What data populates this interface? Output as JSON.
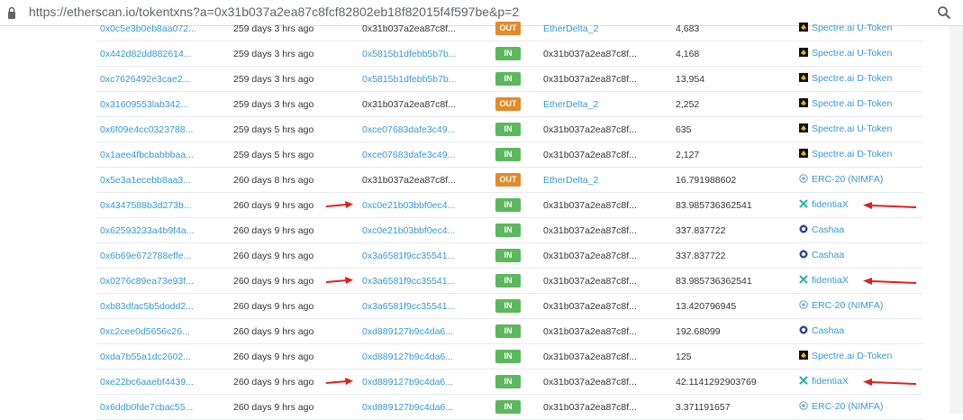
{
  "browser": {
    "url": "https://etherscan.io/tokentxns?a=0x31b037a2ea87c8fcf82802eb18f82015f4f597be&p=2"
  },
  "colors": {
    "link": "#3498db",
    "in_badge": "#5cb85c",
    "out_badge": "#e48a2a",
    "arrow": "#e02020"
  },
  "rows": [
    {
      "hash": "0x0c5e3b0eb8aa072...",
      "age": "259 days 3 hrs ago",
      "from": "0x31b037a2ea87c8f...",
      "from_link": false,
      "dir": "OUT",
      "to": "EtherDelta_2",
      "to_link": true,
      "value": "4,683",
      "token": "Spectre.ai U-Token",
      "icon": "spectre-icon",
      "marked": false
    },
    {
      "hash": "0x442d82dd882614...",
      "age": "259 days 3 hrs ago",
      "from": "0x5815b1dfebb5b7b...",
      "from_link": true,
      "dir": "IN",
      "to": "0x31b037a2ea87c8f...",
      "to_link": false,
      "value": "4,168",
      "token": "Spectre.ai U-Token",
      "icon": "spectre-icon",
      "marked": false
    },
    {
      "hash": "0xc7626492e3cae2...",
      "age": "259 days 3 hrs ago",
      "from": "0x5815b1dfebb5b7b...",
      "from_link": true,
      "dir": "IN",
      "to": "0x31b037a2ea87c8f...",
      "to_link": false,
      "value": "13,954",
      "token": "Spectre.ai D-Token",
      "icon": "spectre-icon",
      "marked": false
    },
    {
      "hash": "0x31609553lab342...",
      "age": "259 days 3 hrs ago",
      "from": "0x31b037a2ea87c8f...",
      "from_link": false,
      "dir": "OUT",
      "to": "EtherDelta_2",
      "to_link": true,
      "value": "2,252",
      "token": "Spectre.ai D-Token",
      "icon": "spectre-icon",
      "marked": false
    },
    {
      "hash": "0x6f09e4cc0323788...",
      "age": "259 days 5 hrs ago",
      "from": "0xce07683dafe3c49...",
      "from_link": true,
      "dir": "IN",
      "to": "0x31b037a2ea87c8f...",
      "to_link": false,
      "value": "635",
      "token": "Spectre.ai U-Token",
      "icon": "spectre-icon",
      "marked": false
    },
    {
      "hash": "0x1aee4fbcbabbbaa...",
      "age": "259 days 5 hrs ago",
      "from": "0xce07683dafe3c49...",
      "from_link": true,
      "dir": "IN",
      "to": "0x31b037a2ea87c8f...",
      "to_link": false,
      "value": "2,127",
      "token": "Spectre.ai D-Token",
      "icon": "spectre-icon",
      "marked": false
    },
    {
      "hash": "0x5e3a1ecebb8aa3...",
      "age": "260 days 8 hrs ago",
      "from": "0x31b037a2ea87c8f...",
      "from_link": false,
      "dir": "OUT",
      "to": "EtherDelta_2",
      "to_link": true,
      "value": "16.791988602",
      "token": "ERC-20 (NIMFA)",
      "icon": "erc20-icon",
      "marked": false
    },
    {
      "hash": "0x4347588b3d273b...",
      "age": "260 days 9 hrs ago",
      "from": "0xc0e21b03bbf0ec4...",
      "from_link": true,
      "dir": "IN",
      "to": "0x31b037a2ea87c8f...",
      "to_link": false,
      "value": "83.985736362541",
      "token": "fidentiaX",
      "icon": "fidentiax-icon",
      "marked": true
    },
    {
      "hash": "0x62593233a4b9f4a...",
      "age": "260 days 9 hrs ago",
      "from": "0xc0e21b03bbf0ec4...",
      "from_link": true,
      "dir": "IN",
      "to": "0x31b037a2ea87c8f...",
      "to_link": false,
      "value": "337.837722",
      "token": "Cashaa",
      "icon": "cashaa-icon",
      "marked": false
    },
    {
      "hash": "0x6b69e672788effe...",
      "age": "260 days 9 hrs ago",
      "from": "0x3a6581f9cc35541...",
      "from_link": true,
      "dir": "IN",
      "to": "0x31b037a2ea87c8f...",
      "to_link": false,
      "value": "337.837722",
      "token": "Cashaa",
      "icon": "cashaa-icon",
      "marked": false
    },
    {
      "hash": "0x0276c89ea73e93f...",
      "age": "260 days 9 hrs ago",
      "from": "0x3a6581f9cc35541...",
      "from_link": true,
      "dir": "IN",
      "to": "0x31b037a2ea87c8f...",
      "to_link": false,
      "value": "83.985736362541",
      "token": "fidentiaX",
      "icon": "fidentiax-icon",
      "marked": true
    },
    {
      "hash": "0xb83dfac5b5dodd2...",
      "age": "260 days 9 hrs ago",
      "from": "0x3a6581f9cc35541...",
      "from_link": true,
      "dir": "IN",
      "to": "0x31b037a2ea87c8f...",
      "to_link": false,
      "value": "13.420796945",
      "token": "ERC-20 (NIMFA)",
      "icon": "erc20-icon",
      "marked": false
    },
    {
      "hash": "0xc2cee0d5656c26...",
      "age": "260 days 9 hrs ago",
      "from": "0xd889127b9c4da6...",
      "from_link": true,
      "dir": "IN",
      "to": "0x31b037a2ea87c8f...",
      "to_link": false,
      "value": "192.68099",
      "token": "Cashaa",
      "icon": "cashaa-icon",
      "marked": false
    },
    {
      "hash": "0xda7b55a1dc2602...",
      "age": "260 days 9 hrs ago",
      "from": "0xd889127b9c4da6...",
      "from_link": true,
      "dir": "IN",
      "to": "0x31b037a2ea87c8f...",
      "to_link": false,
      "value": "125",
      "token": "Spectre.ai D-Token",
      "icon": "spectre-icon",
      "marked": false
    },
    {
      "hash": "0xe22bc6aaebf4439...",
      "age": "260 days 9 hrs ago",
      "from": "0xd889127b9c4da6...",
      "from_link": true,
      "dir": "IN",
      "to": "0x31b037a2ea87c8f...",
      "to_link": false,
      "value": "42.1141292903769",
      "token": "fidentiaX",
      "icon": "fidentiax-icon",
      "marked": true
    },
    {
      "hash": "0x6ddb0fde7cbac55...",
      "age": "260 days 9 hrs ago",
      "from": "0xd889127b9c4da6...",
      "from_link": true,
      "dir": "IN",
      "to": "0x31b037a2ea87c8f...",
      "to_link": false,
      "value": "3.371191657",
      "token": "ERC-20 (NIMFA)",
      "icon": "erc20-icon",
      "marked": false
    }
  ]
}
